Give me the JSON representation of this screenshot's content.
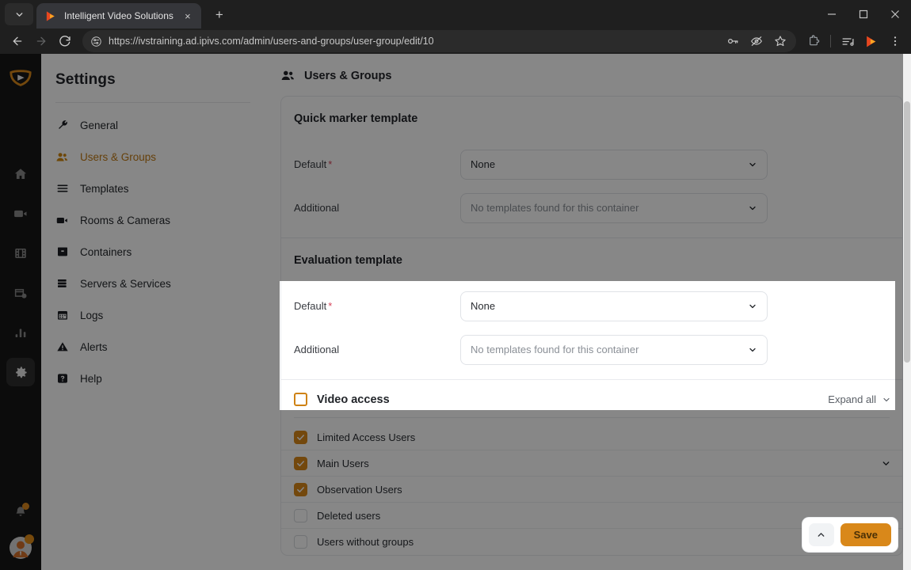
{
  "browser": {
    "tab": {
      "title": "Intelligent Video Solutions",
      "favicon": "ivs-play-logo-icon",
      "close_label": "×"
    },
    "new_tab_label": "+",
    "tab_list_icon": "chevron-down-icon",
    "window_controls": {
      "minimize": "–",
      "maximize": "□",
      "close": "✕"
    },
    "nav": {
      "back": "back-arrow-icon",
      "forward": "forward-arrow-icon",
      "reload": "reload-icon"
    },
    "omnibox": {
      "url": "https://ivstraining.ad.ipivs.com/admin/users-and-groups/user-group/edit/10",
      "site_info_icon": "page-settings-icon",
      "actions": [
        "password-key-icon",
        "eye-slash-icon",
        "bookmark-star-icon"
      ]
    },
    "toolbar_actions": [
      "extensions-puzzle-icon",
      "reading-list-icon",
      "ivs-profile-icon",
      "chrome-menu-icon"
    ]
  },
  "rail": {
    "logo": "ivs-shield-logo-icon",
    "items": [
      {
        "name": "home",
        "icon": "home-icon",
        "active": false
      },
      {
        "name": "live-video",
        "icon": "video-camera-icon",
        "active": false
      },
      {
        "name": "recordings",
        "icon": "film-strip-icon",
        "active": false
      },
      {
        "name": "scheduling",
        "icon": "calendar-clock-icon",
        "active": false
      },
      {
        "name": "analytics",
        "icon": "bar-chart-icon",
        "active": false
      },
      {
        "name": "settings",
        "icon": "gear-icon",
        "active": true
      }
    ],
    "bell": {
      "icon": "bell-icon",
      "has_badge": true
    },
    "avatar": {
      "icon": "user-avatar-icon",
      "has_badge": true
    }
  },
  "settings": {
    "title": "Settings",
    "items": [
      {
        "label": "General",
        "icon": "wrench-icon",
        "active": false
      },
      {
        "label": "Users & Groups",
        "icon": "users-group-icon",
        "active": true
      },
      {
        "label": "Templates",
        "icon": "list-lines-icon",
        "active": false
      },
      {
        "label": "Rooms & Cameras",
        "icon": "video-camera-icon",
        "active": false
      },
      {
        "label": "Containers",
        "icon": "box-icon",
        "active": false
      },
      {
        "label": "Servers & Services",
        "icon": "server-stack-icon",
        "active": false
      },
      {
        "label": "Logs",
        "icon": "calendar-icon",
        "active": false
      },
      {
        "label": "Alerts",
        "icon": "alert-triangle-icon",
        "active": false
      },
      {
        "label": "Help",
        "icon": "help-question-icon",
        "active": false
      }
    ]
  },
  "page": {
    "heading": "Users & Groups",
    "heading_icon": "users-group-icon",
    "quick_marker": {
      "title": "Quick marker template",
      "default_label": "Default",
      "default_required": "*",
      "default_value": "None",
      "additional_label": "Additional",
      "additional_value": "No templates found for this container"
    },
    "evaluation": {
      "title": "Evaluation template",
      "default_label": "Default",
      "default_required": "*",
      "default_value": "None",
      "additional_label": "Additional",
      "additional_value": "No templates found for this container",
      "highlighted": true
    },
    "video_access": {
      "title": "Video access",
      "checkbox_state": "unchecked-outline",
      "expand_all_label": "Expand all",
      "expand_icon": "chevron-down-icon",
      "rows": [
        {
          "label": "Limited Access Users",
          "checked": true,
          "expandable": false
        },
        {
          "label": "Main Users",
          "checked": true,
          "expandable": true
        },
        {
          "label": "Observation Users",
          "checked": true,
          "expandable": false
        },
        {
          "label": "Deleted users",
          "checked": false,
          "expandable": false
        },
        {
          "label": "Users without groups",
          "checked": false,
          "expandable": false
        }
      ]
    },
    "save_bar": {
      "scroll_top_icon": "chevron-up-icon",
      "save_label": "Save"
    }
  },
  "colors": {
    "accent": "#d9881a",
    "accent_text": "#c07a14",
    "required": "#d6455b",
    "rail_bg": "#181818",
    "chrome_bg": "#1f1f1f",
    "page_bg": "#ffffff"
  }
}
